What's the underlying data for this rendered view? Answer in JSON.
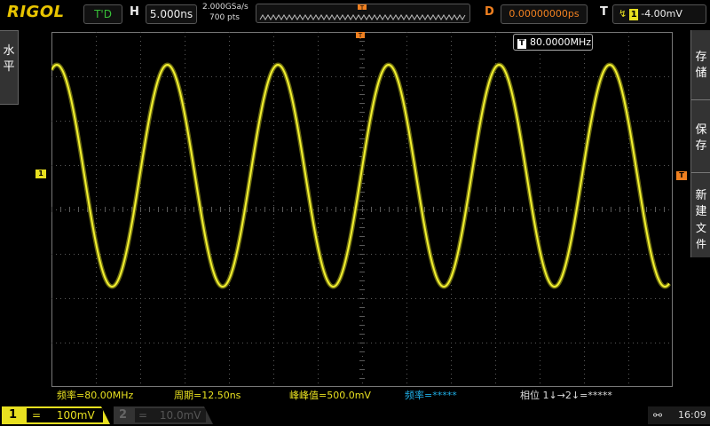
{
  "header": {
    "brand": "RIGOL",
    "run_mode": "T'D",
    "horizontal_label": "H",
    "horizontal_scale": "5.000ns",
    "sample_rate": "2.000GSa/s",
    "memory_depth": "700 pts",
    "delay_label": "D",
    "delay_value": "0.00000000ps",
    "trigger_label": "T",
    "trigger_source": "1",
    "trigger_level": "-4.00mV"
  },
  "left_menu": {
    "label_line1": "水",
    "label_line2": "平"
  },
  "right_menu": {
    "items": [
      {
        "l1": "存",
        "l2": "储",
        "l3": ""
      },
      {
        "l1": "保",
        "l2": "存",
        "l3": ""
      },
      {
        "l1": "新",
        "l2": "建",
        "l3": "文件"
      }
    ]
  },
  "screen": {
    "freq_counter_tag": "T",
    "freq_counter_value": "80.0000MHz",
    "ch1_marker": "1",
    "trigger_marker": "T"
  },
  "measurements": {
    "freq": "频率=80.00MHz",
    "period": "周期=12.50ns",
    "vpp": "峰峰值=500.0mV",
    "freq2": "频率=*****",
    "phase": "相位 1↓→2↓=*****"
  },
  "channels": {
    "ch1": {
      "num": "1",
      "scale": "100mV"
    },
    "ch2": {
      "num": "2",
      "scale": "10.0mV"
    }
  },
  "status": {
    "usb": "⮜",
    "time": "16:09"
  },
  "colors": {
    "ch1": "#e8e020",
    "trigger": "#f08020",
    "grid": "#5a5a5a"
  }
}
